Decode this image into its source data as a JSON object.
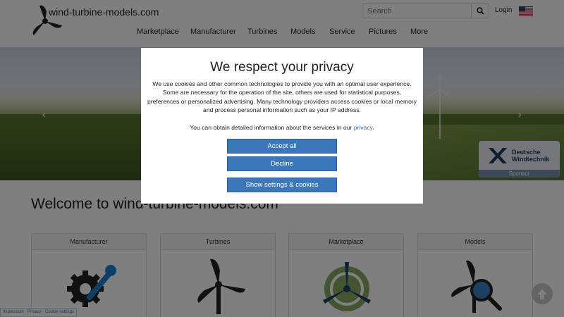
{
  "header": {
    "site_name": "wind-turbine-models.com",
    "search_placeholder": "Search",
    "login_label": "Login",
    "nav": [
      "Marketplace",
      "Manufacturer",
      "Turbines",
      "Models",
      "Service",
      "Pictures",
      "More"
    ]
  },
  "hero": {
    "sponsor_name_line1": "Deutsche",
    "sponsor_name_line2": "Windtechnik",
    "sponsor_label": "Sponsor"
  },
  "main": {
    "welcome_title": "Welcome to wind-turbine-models.com",
    "cards": [
      "Manufacturer",
      "Turbines",
      "Marketplace",
      "Models"
    ]
  },
  "footer": {
    "links": "Impressum · Privacy · Cookie settings"
  },
  "cookie_modal": {
    "title": "We respect your privacy",
    "body": "We use cookies and other common technologies to provide you with an optimal user experience. Some are necessary for the operation of the site, others are used for statistical purposes, preferences or personalized advertising. Many technology providers access cookies or local memory and process personal information such as your IP address.",
    "services_text": "You can obtain detailed information about the services in our",
    "privacy_link": "privacy",
    "accept_all": "Accept all",
    "decline": "Decline",
    "show_settings": "Show settings & cookies"
  },
  "colors": {
    "primary_button": "#3c78b9",
    "link": "#3a6fb0",
    "overlay": "rgba(0,0,0,0.5)"
  }
}
